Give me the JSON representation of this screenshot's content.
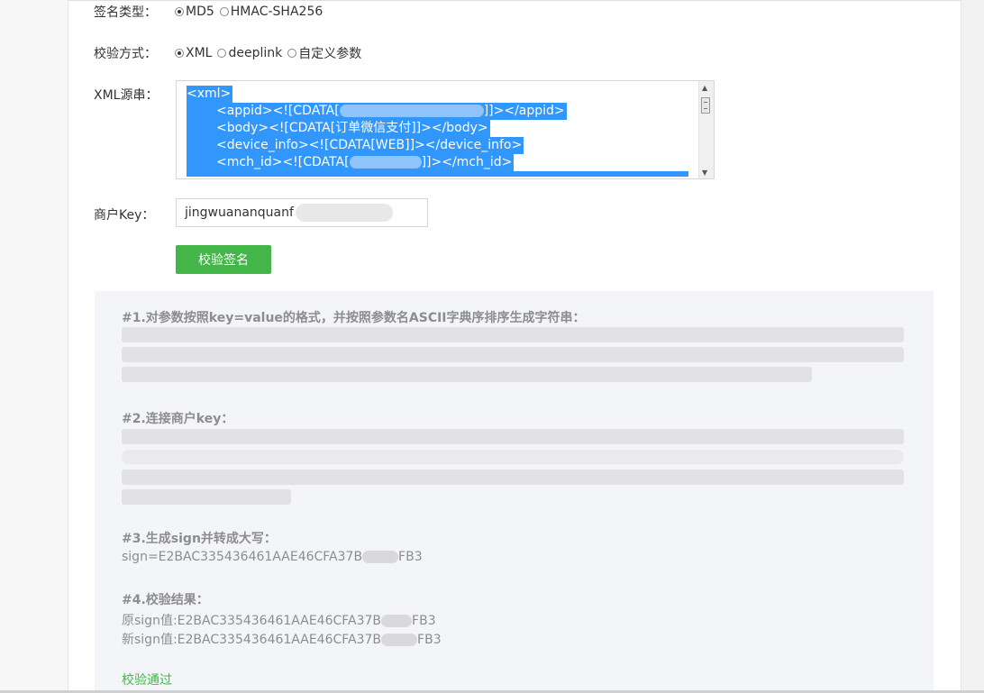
{
  "form": {
    "sign_type": {
      "label": "签名类型：",
      "options": [
        {
          "label": "MD5",
          "checked": true
        },
        {
          "label": "HMAC-SHA256",
          "checked": false
        }
      ]
    },
    "verify_method": {
      "label": "校验方式：",
      "options": [
        {
          "label": "XML",
          "checked": true
        },
        {
          "label": "deeplink",
          "checked": false
        },
        {
          "label": "自定义参数",
          "checked": false
        }
      ]
    },
    "xml_source": {
      "label": "XML源串：",
      "lines": [
        "<xml>",
        "<appid><![CDATA[",
        "]]></appid>",
        "<body><![CDATA[订单微信支付]]></body>",
        "<device_info><![CDATA[WEB]]></device_info>",
        "<mch_id><![CDATA[",
        "]]></mch_id>"
      ]
    },
    "merchant_key": {
      "label": "商户Key：",
      "value": "jingwuananquanf"
    },
    "verify_button": "校验签名"
  },
  "results": {
    "step1_title": "#1.对参数按照key=value的格式，并按照参数名ASCII字典序排序生成字符串：",
    "step2_title": "#2.连接商户key：",
    "step3_title": "#3.生成sign并转成大写：",
    "step3_sign_prefix": "sign=E2BAC335436461AAE46CFA37B",
    "step3_sign_suffix": "FB3",
    "step4_title": "#4.校验结果：",
    "orig_sign_prefix": "原sign值:E2BAC335436461AAE46CFA37B",
    "orig_sign_suffix": "FB3",
    "new_sign_prefix": "新sign值:E2BAC335436461AAE46CFA37B",
    "new_sign_suffix": "FB3",
    "pass_text": "校验通过"
  }
}
